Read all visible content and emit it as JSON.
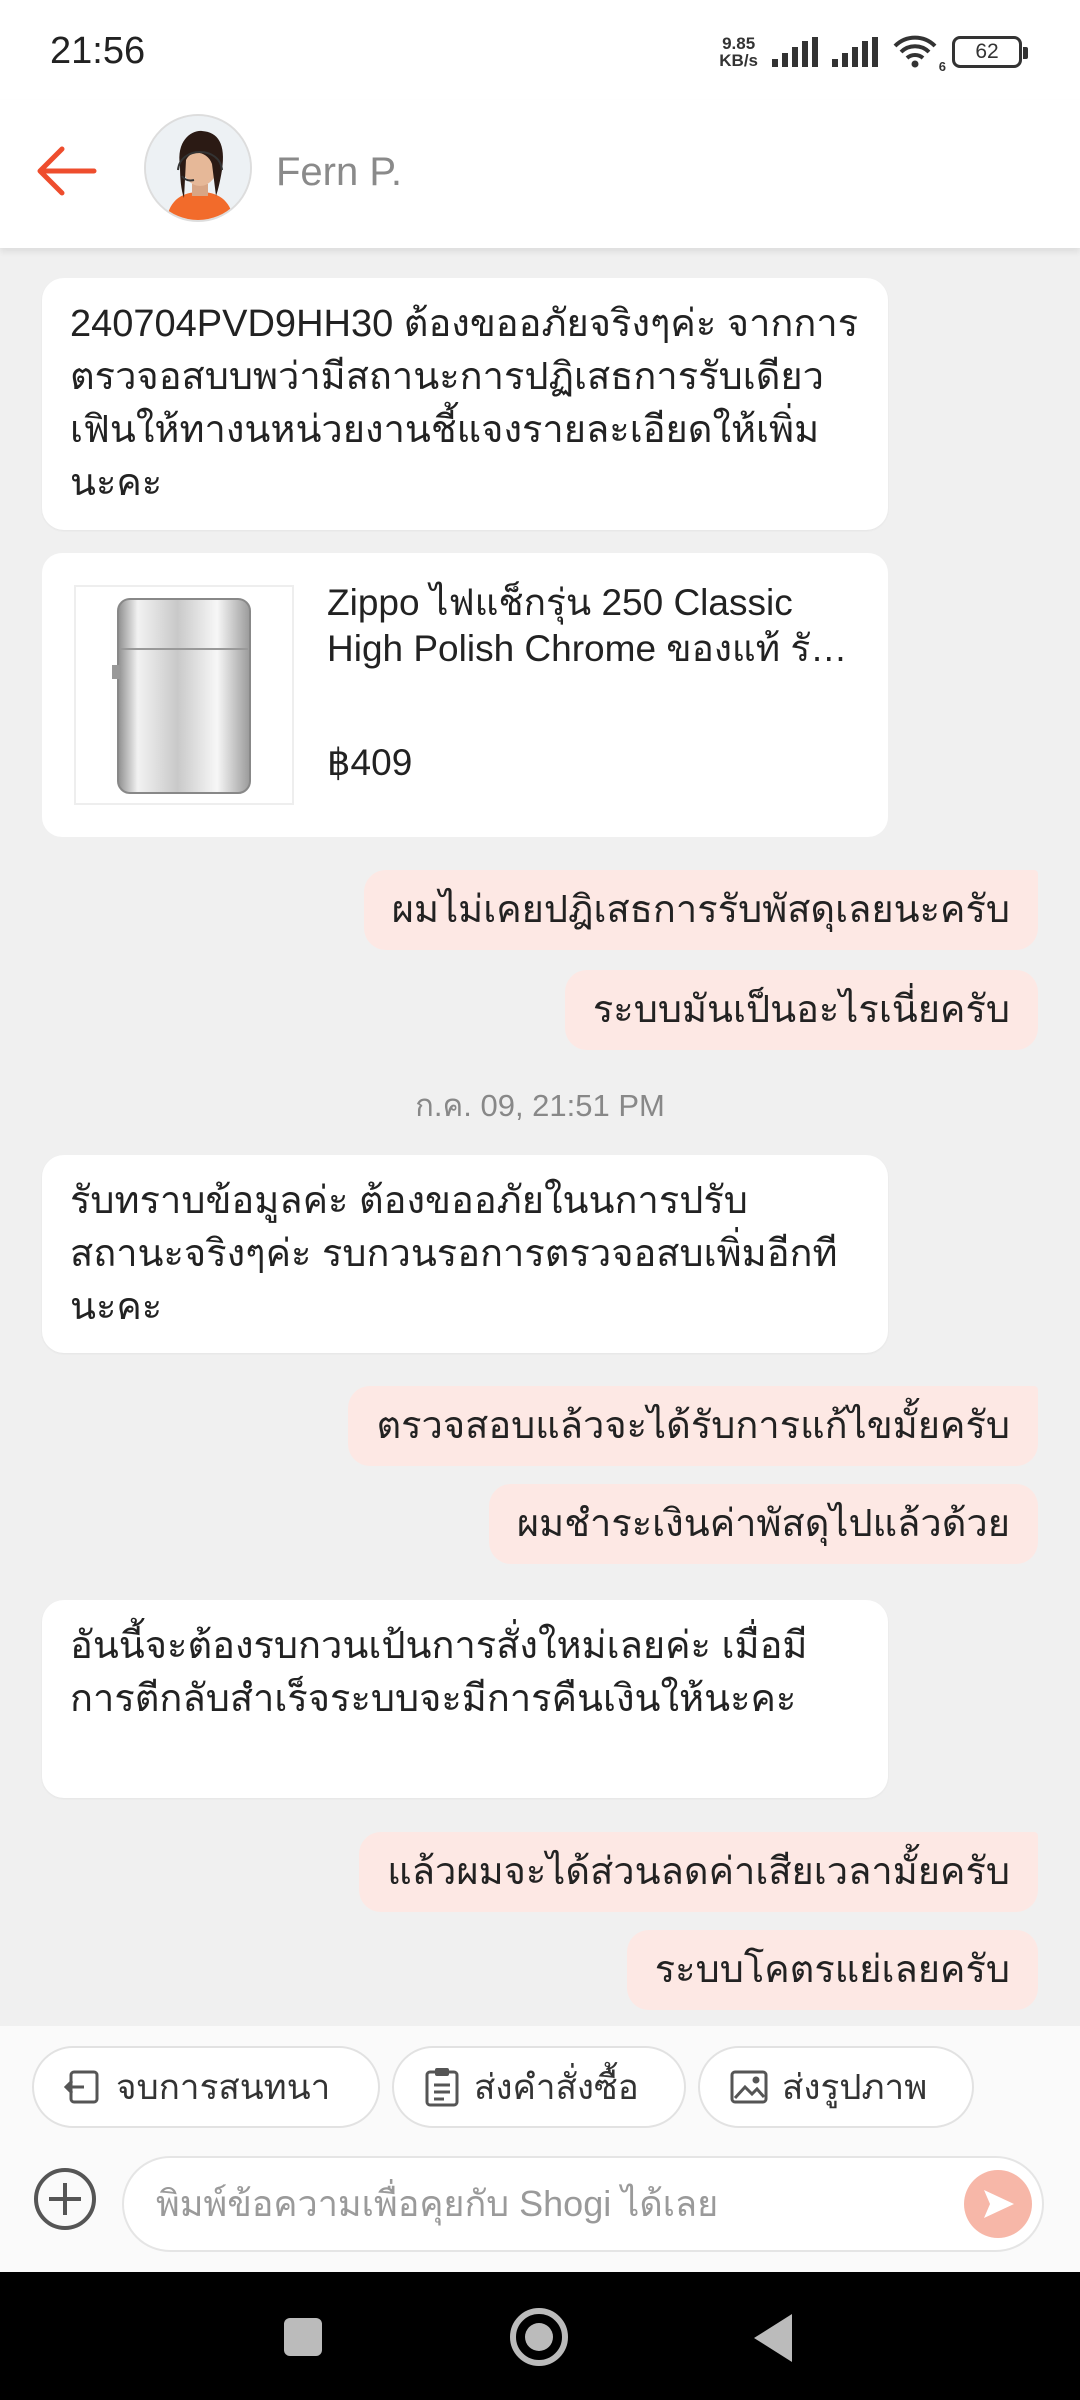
{
  "status_bar": {
    "time": "21:56",
    "net_speed_value": "9.85",
    "net_speed_unit": "KB/s",
    "wifi_badge": "6",
    "battery": "62",
    "icons": [
      "signal-icon",
      "signal-icon",
      "wifi-icon",
      "battery-icon"
    ]
  },
  "header": {
    "contact_name": "Fern P.",
    "back_icon": "arrow-left-icon",
    "accent_color": "#ee4d2d"
  },
  "messages": [
    {
      "side": "in",
      "text": "240704PVD9HH30  ต้องขออภัยจริงๆค่ะ จากการตรวจอสบบพว่ามีสถานะการปฏิเสธการรับเดียวเฟินให้ทางนหน่วยงานชี้แจงรายละเอียดให้เพิ่มนะคะ"
    },
    {
      "side": "out",
      "text": "ผมไม่เคยปฎิเสธการรับพัสดุเลยนะครับ"
    },
    {
      "side": "out",
      "text": "ระบบมันเป็นอะไรเนี่ยครับ"
    },
    {
      "side": "in",
      "text": "รับทราบข้อมูลค่ะ ต้องขออภัยในนการปรับสถานะจริงๆค่ะ รบกวนรอการตรวจอสบเพิ่มอีกทีนะคะ"
    },
    {
      "side": "out",
      "text": "ตรวจสอบแล้วจะได้รับการแก้ไขมั้ยครับ"
    },
    {
      "side": "out",
      "text": "ผมชำระเงินค่าพัสดุไปแล้วด้วย"
    },
    {
      "side": "in",
      "text": "อันนี้จะต้องรบกวนเป้นการสั่งใหม่เลยค่ะ เมื่อมีการตีกลับสำเร็จระบบจะมีการคืนเงินให้นะคะ"
    },
    {
      "side": "out",
      "text": "แล้วผมจะได้ส่วนลดค่าเสียเวลามั้ยครับ"
    },
    {
      "side": "out",
      "text": "ระบบโคตรแย่เลยครับ"
    }
  ],
  "product": {
    "title_line1": "Zippo ไฟแช็กรุ่น 250 Classic",
    "title_line2": "High Polish Chrome ของแท้ รั…",
    "price": "฿409"
  },
  "timestamp": "ก.ค. 09, 21:51 PM",
  "actions": [
    {
      "label": "จบการสนทนา",
      "icon": "exit-chat-icon"
    },
    {
      "label": "ส่งคำสั่งซื้อ",
      "icon": "clipboard-icon"
    },
    {
      "label": "ส่งรูปภาพ",
      "icon": "image-icon"
    }
  ],
  "composer": {
    "placeholder": "พิมพ์ข้อความเพื่อคุยกับ Shogi ได้เลย",
    "add_icon": "plus-circle-icon",
    "send_icon": "send-icon"
  },
  "nav": {
    "icons": [
      "recents-icon",
      "home-icon",
      "back-icon"
    ]
  }
}
